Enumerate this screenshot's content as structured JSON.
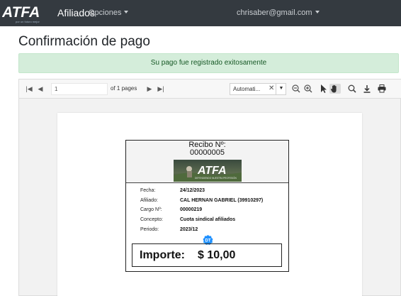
{
  "navbar": {
    "logo_text": "ATFA",
    "logo_tagline": "por un futuro mejor",
    "brand": "Afiliados",
    "menu_label": "Opciones",
    "user_email": "chrisaber@gmail.com"
  },
  "page": {
    "title": "Confirmación de pago"
  },
  "alert": {
    "message": "Su pago fue registrado exitosamente"
  },
  "viewer": {
    "page_number": "1",
    "page_total": "of 1 pages",
    "zoom": "Automati...",
    "icons": [
      "first-page-icon",
      "prev-page-icon",
      "next-page-icon",
      "last-page-icon",
      "zoom-out-icon",
      "zoom-in-icon",
      "pointer-icon",
      "hand-icon",
      "search-icon",
      "download-icon",
      "print-icon"
    ]
  },
  "receipt": {
    "title": "Recibo Nº:",
    "number": "00000005",
    "banner_text": "ATFA",
    "banner_tagline": "DEFENDIENDO NUESTRA PROFESIÓN",
    "fields": [
      {
        "label": "Fecha:",
        "value": "24/12/2023"
      },
      {
        "label": "Afiliado:",
        "value": "CAL HERNAN GABRIEL (39910297)"
      },
      {
        "label": "Cargo Nº:",
        "value": "00000219"
      },
      {
        "label": "Concepto:",
        "value": "Cuota  sindical afiliados"
      },
      {
        "label": "Periodo:",
        "value": "2023/12"
      }
    ],
    "badge": "DT",
    "importe_label": "Importe:",
    "importe_value": "$ 10,00"
  },
  "colors": {
    "navbar_bg": "#343a40",
    "alert_bg": "#d4edda",
    "alert_text": "#155724",
    "badge": "#1e90ff"
  }
}
